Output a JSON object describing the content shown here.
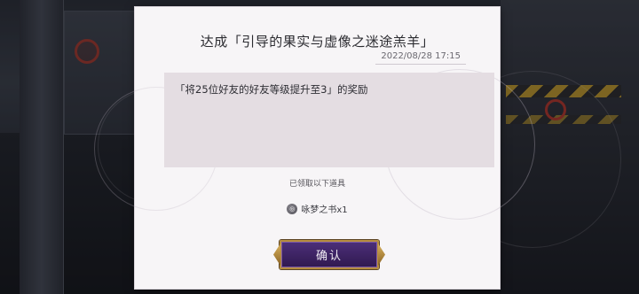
{
  "dialog": {
    "title": "达成「引导的果实与虚像之迷途羔羊」",
    "timestamp": "2022/08/28 17:15",
    "message": "「将25位好友的好友等级提升至3」的奖励",
    "received_label": "已领取以下道具",
    "items": [
      {
        "icon": "dream-book-icon",
        "name": "咏梦之书x1"
      }
    ],
    "confirm_label": "确认"
  },
  "colors": {
    "dialog_bg": "#f7f5f7",
    "message_bg": "#e4dde2",
    "button_purple": "#4c2f7a",
    "button_gold": "#b68d3f"
  }
}
